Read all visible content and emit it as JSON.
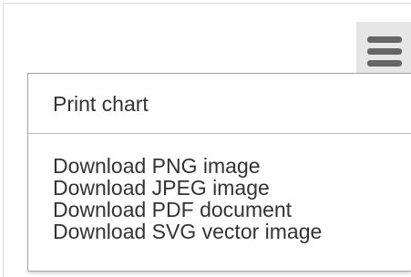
{
  "menu": {
    "button_icon": "hamburger-menu-icon",
    "items": [
      {
        "label": "Print chart"
      },
      {
        "label": "Download PNG image"
      },
      {
        "label": "Download JPEG image"
      },
      {
        "label": "Download PDF document"
      },
      {
        "label": "Download SVG vector image"
      }
    ]
  },
  "colors": {
    "menu_button_bg": "#e6e6e6",
    "menu_icon": "#666666",
    "item_text": "#333333",
    "separator": "#c2c2c2"
  }
}
